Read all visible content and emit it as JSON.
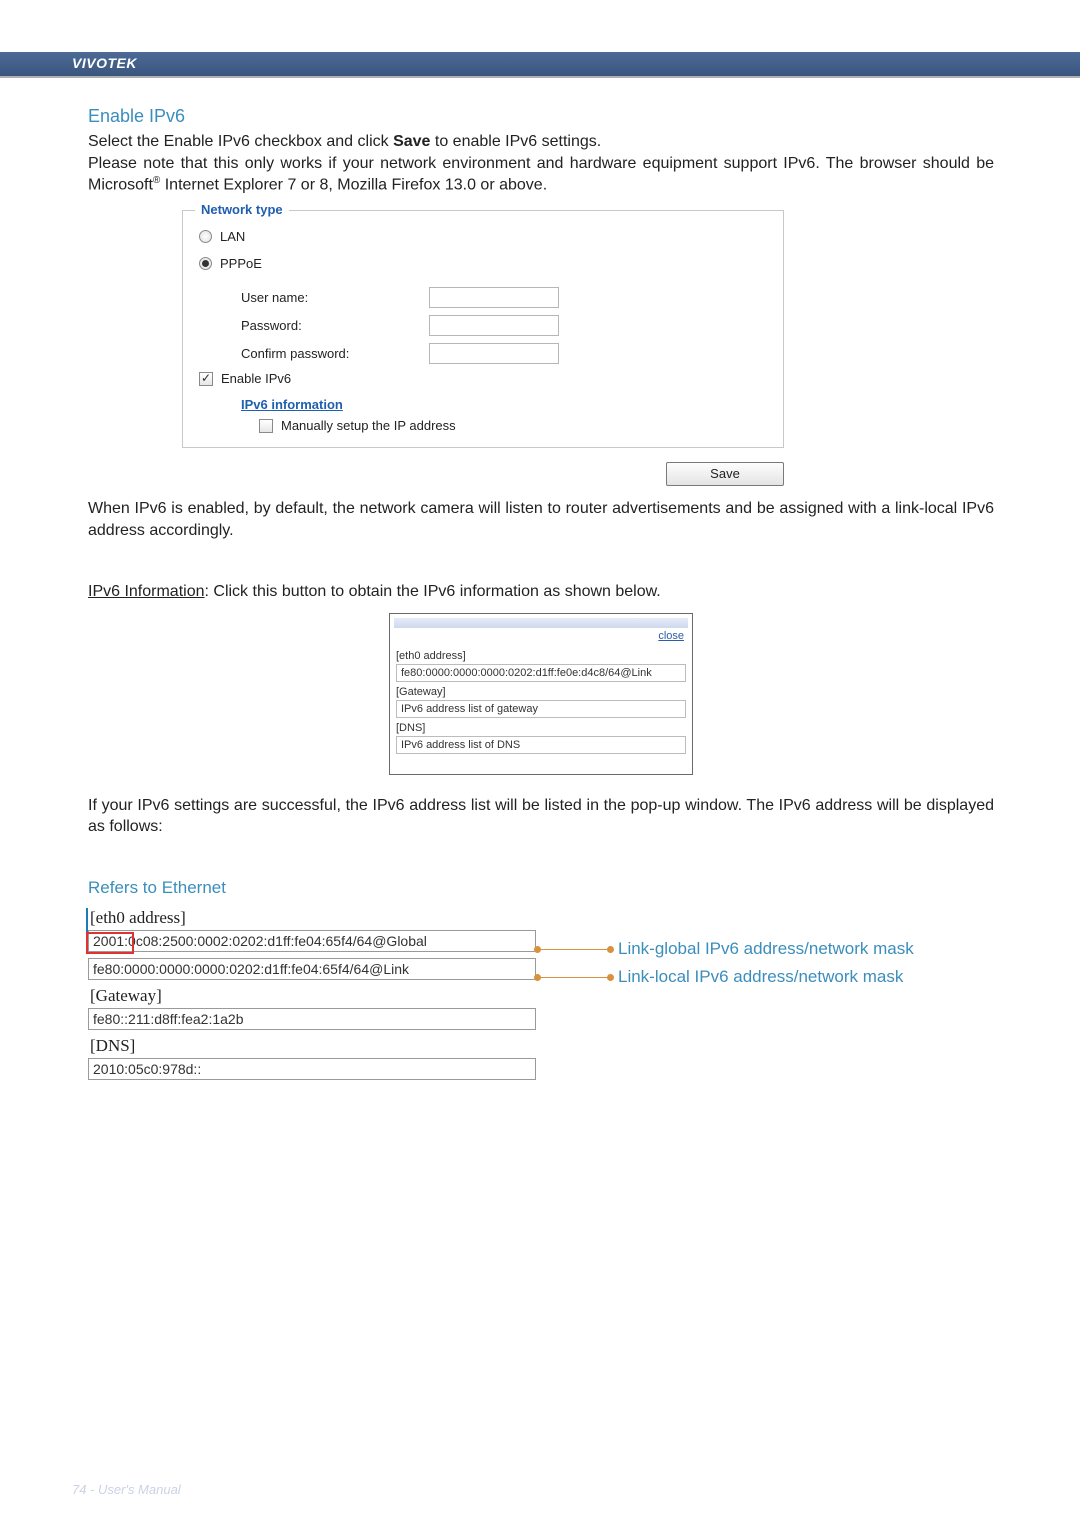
{
  "brand": "VIVOTEK",
  "headings": {
    "enable_ipv6": "Enable IPv6",
    "refers": "Refers to Ethernet"
  },
  "paragraphs": {
    "intro1_a": "Select the Enable IPv6 checkbox and click ",
    "intro1_save": "Save",
    "intro1_b": " to enable IPv6 settings.",
    "intro2_a": "Please note that this only works if your network environment and hardware equipment support IPv6. The browser should be Microsoft",
    "intro2_sup": "®",
    "intro2_b": " Internet Explorer 7 or 8, Mozilla Firefox 13.0 or above.",
    "after_save": "When IPv6 is enabled, by default, the network camera will listen to router advertisements and be assigned with a link-local IPv6 address accordingly.",
    "ipv6_info_label": "IPv6 Information",
    "ipv6_info_text": ": Click this button to obtain the IPv6 information as shown below.",
    "after_popup": "If your IPv6 settings are successful, the IPv6 address list will be listed in the pop-up window. The IPv6 address will be displayed as follows:"
  },
  "network_type": {
    "legend": "Network type",
    "lan_label": "LAN",
    "pppoe_label": "PPPoE",
    "username_label": "User name:",
    "password_label": "Password:",
    "confirm_label": "Confirm password:",
    "enable_ipv6_label": "Enable IPv6",
    "ipv6_info_link": "IPv6 information",
    "manual_label": "Manually setup the IP address",
    "save_button": "Save",
    "lan_selected": false,
    "pppoe_selected": true,
    "enable_ipv6_checked": true,
    "manual_checked": false
  },
  "popup": {
    "close": "close",
    "eth0_hdr": "[eth0 address]",
    "eth0_val": "fe80:0000:0000:0000:0202:d1ff:fe0e:d4c8/64@Link",
    "gateway_hdr": "[Gateway]",
    "gateway_val": "IPv6 address list of gateway",
    "dns_hdr": "[DNS]",
    "dns_val": "IPv6 address list of DNS"
  },
  "eth_diagram": {
    "eth0_hdr": "[eth0 address]",
    "global_addr": "2001:0c08:2500:0002:0202:d1ff:fe04:65f4/64@Global",
    "link_addr": "fe80:0000:0000:0000:0202:d1ff:fe04:65f4/64@Link",
    "gateway_hdr": "[Gateway]",
    "gateway_val": "fe80::211:d8ff:fea2:1a2b",
    "dns_hdr": "[DNS]",
    "dns_val": "2010:05c0:978d::",
    "callout_global": "Link-global IPv6 address/network mask",
    "callout_local": "Link-local IPv6 address/network mask"
  },
  "footer": "74 - User's Manual"
}
